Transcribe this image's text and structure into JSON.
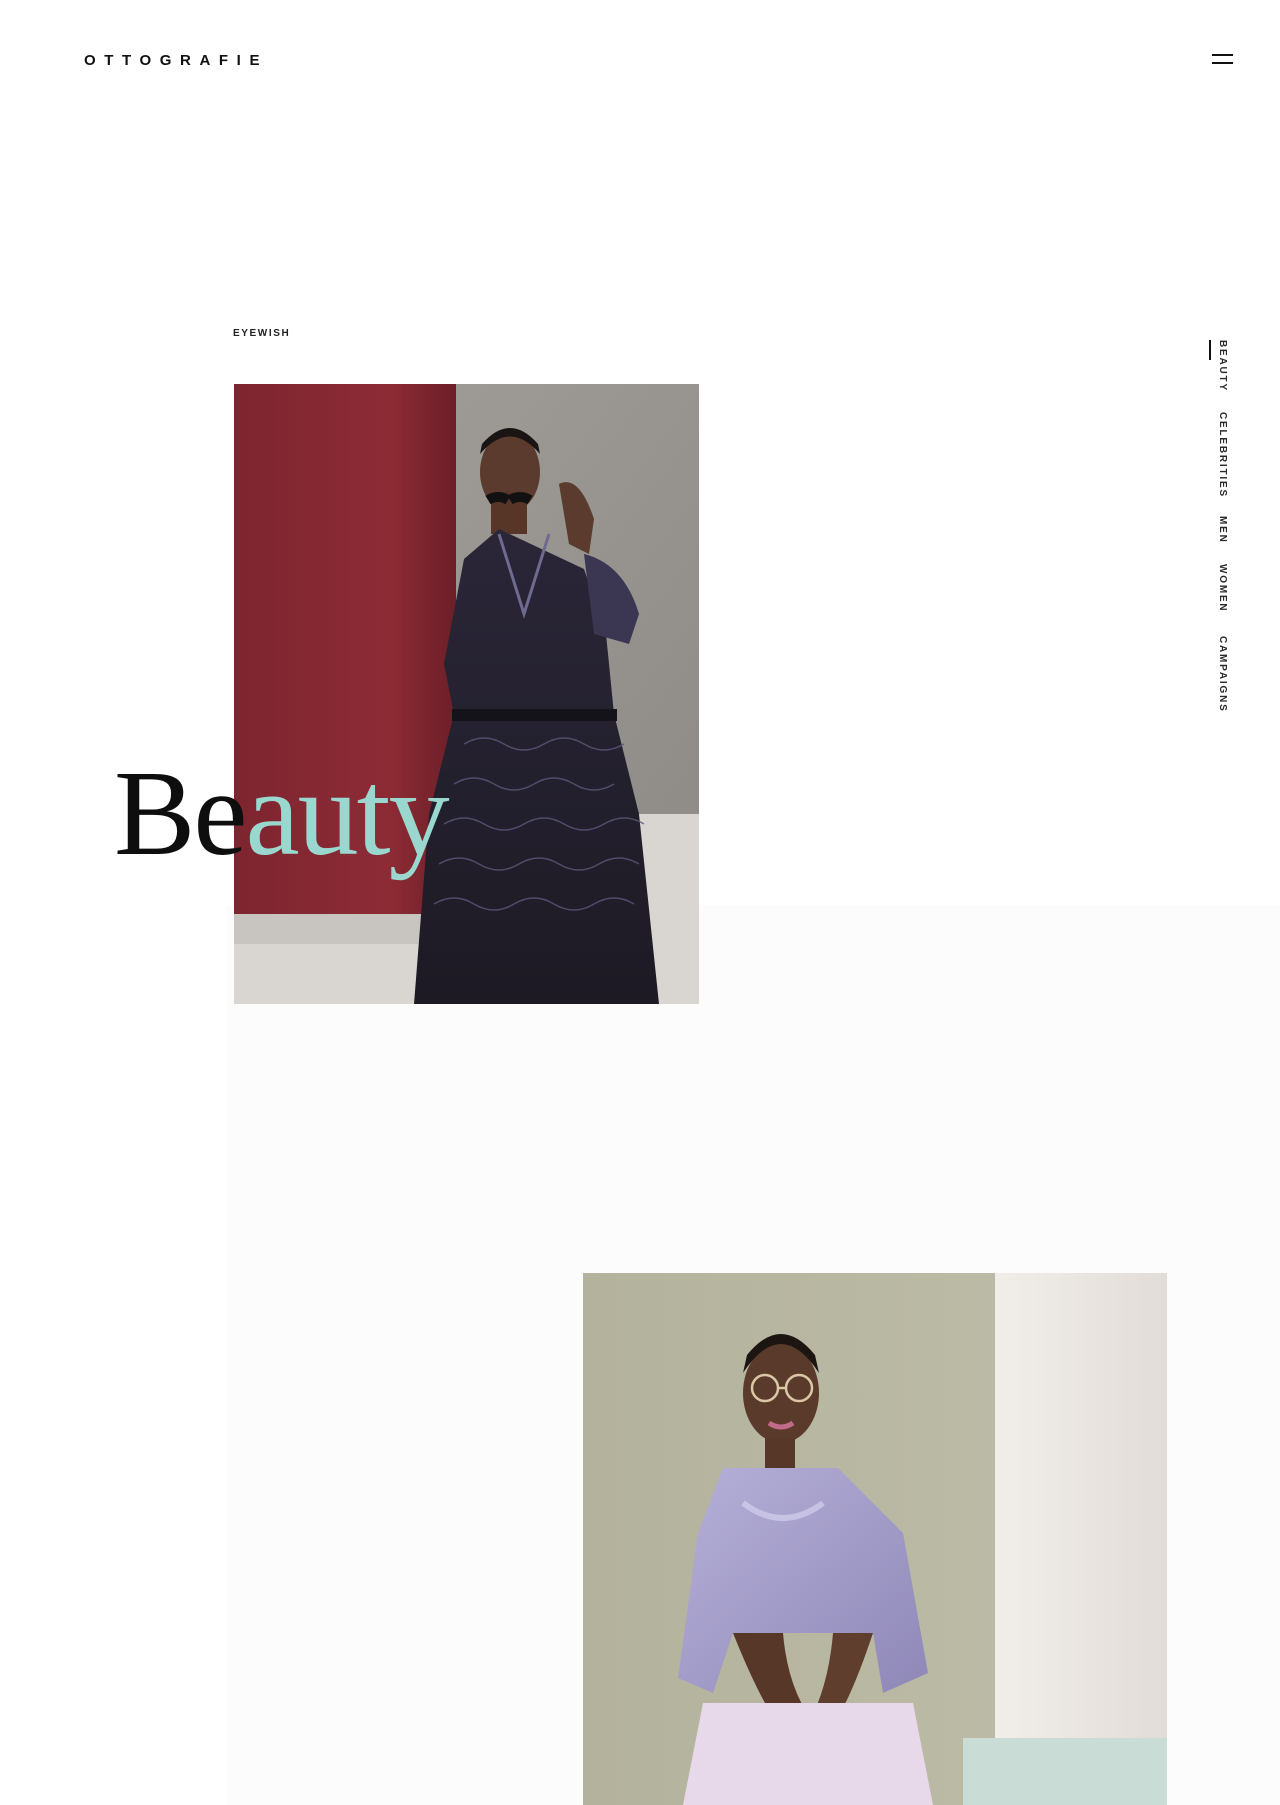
{
  "header": {
    "logo": "OTTOGRAFIE",
    "menu_icon": "hamburger-menu-icon"
  },
  "section": {
    "eyebrow": "EYEWISH",
    "title_part1": "Be",
    "title_part2": "auty",
    "title_accent_color": "#9ad8cf"
  },
  "side_nav": {
    "items": [
      {
        "label": "BEAUTY",
        "active": true
      },
      {
        "label": "CELEBRITIES",
        "active": false
      },
      {
        "label": "MEN",
        "active": false
      },
      {
        "label": "WOMEN",
        "active": false
      },
      {
        "label": "CAMPAIGNS",
        "active": false
      }
    ]
  },
  "colors": {
    "text": "#111111",
    "accent": "#9ad8cf",
    "photo1_backdrop_red": "#8a2a33",
    "photo2_backdrop_sage": "#b9b8a2"
  }
}
